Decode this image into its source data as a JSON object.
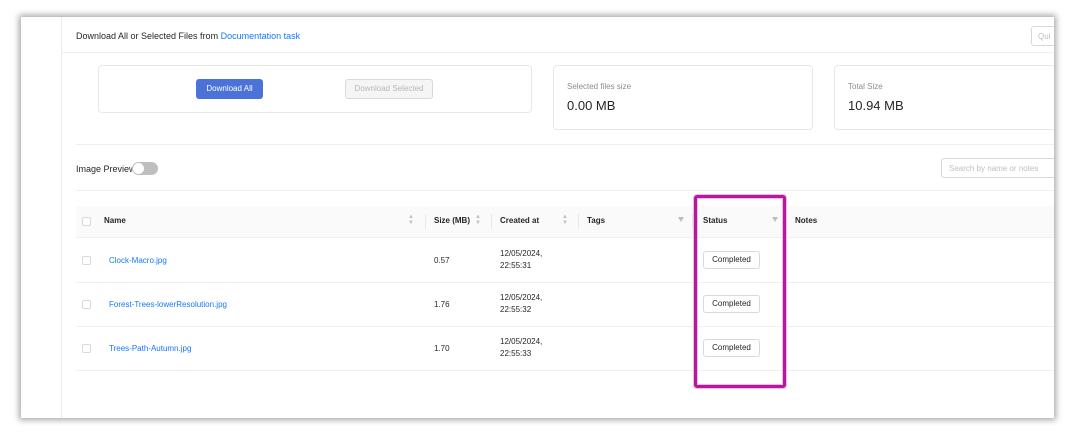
{
  "header": {
    "title_prefix": "Download All or Selected Files from",
    "task_link": "Documentation task",
    "quick_input_placeholder": "Qui"
  },
  "actions": {
    "download_all": "Download All",
    "download_selected": "Download Selected"
  },
  "stats": {
    "selected_label": "Selected files size",
    "selected_value": "0.00 MB",
    "total_label": "Total Size",
    "total_value": "10.94 MB"
  },
  "controls": {
    "image_preview_label": "Image Preview",
    "image_preview_on": false,
    "search_placeholder": "Search by name or notes"
  },
  "table": {
    "columns": {
      "name": "Name",
      "size": "Size (MB)",
      "created": "Created at",
      "tags": "Tags",
      "status": "Status",
      "notes": "Notes"
    },
    "rows": [
      {
        "name": "Clock-Macro.jpg",
        "size": "0.57",
        "date": "12/05/2024,",
        "time": "22:55:31",
        "status": "Completed"
      },
      {
        "name": "Forest-Trees-lowerResolution.jpg",
        "size": "1.76",
        "date": "12/05/2024,",
        "time": "22:55:32",
        "status": "Completed"
      },
      {
        "name": "Trees-Path-Autumn.jpg",
        "size": "1.70",
        "date": "12/05/2024,",
        "time": "22:55:33",
        "status": "Completed"
      }
    ]
  },
  "colors": {
    "primary": "#4b72d9",
    "link": "#1677ff",
    "highlight": "#b5199c"
  }
}
